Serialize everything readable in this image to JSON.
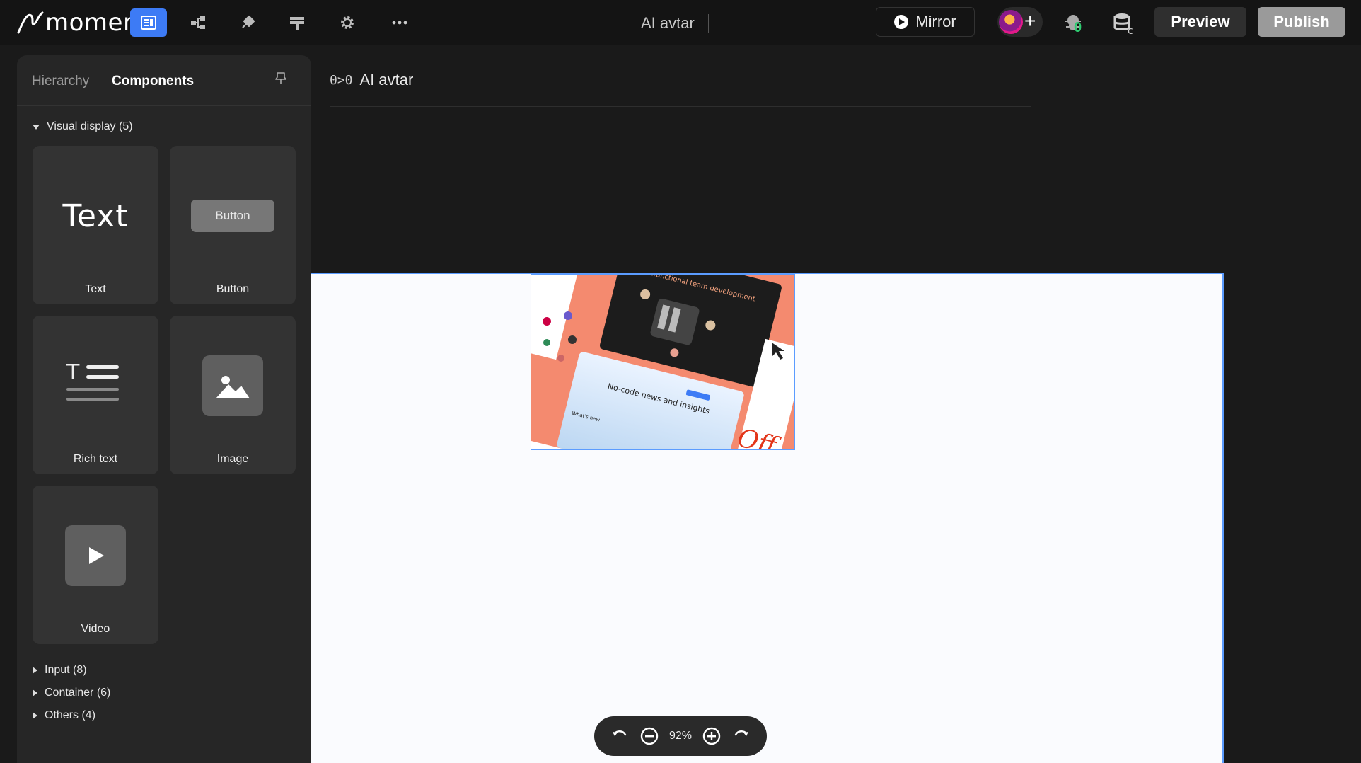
{
  "app": {
    "brand": "momen",
    "project_title": "AI avtar"
  },
  "topbar": {
    "mirror_label": "Mirror",
    "preview_label": "Preview",
    "publish_label": "Publish",
    "debug_count": "0"
  },
  "sidebar": {
    "tabs": [
      "Hierarchy",
      "Components"
    ],
    "active_tab": "Components",
    "visual_display_label": "Visual display (5)",
    "components": [
      {
        "label": "Text",
        "preview": "Text"
      },
      {
        "label": "Button",
        "preview": "Button"
      },
      {
        "label": "Rich text"
      },
      {
        "label": "Image"
      },
      {
        "label": "Video"
      }
    ],
    "collapsed_sections": [
      "Input (8)",
      "Container (6)",
      "Others (4)"
    ]
  },
  "canvas": {
    "page_title": "AI avtar",
    "page_icon_glyph": "0>0",
    "image_texts": {
      "headline": "Multifunctional team development",
      "news": "No-code news and insights",
      "whats_new": "What's new",
      "off": "Off"
    }
  },
  "zoom": {
    "value": "92%"
  },
  "colors": {
    "accent": "#3d7bf5",
    "selection": "#5b9cff",
    "debug_count": "#2ecc71",
    "publish_bg": "#9a9a9a",
    "preview_bg": "#2f2f2f"
  }
}
